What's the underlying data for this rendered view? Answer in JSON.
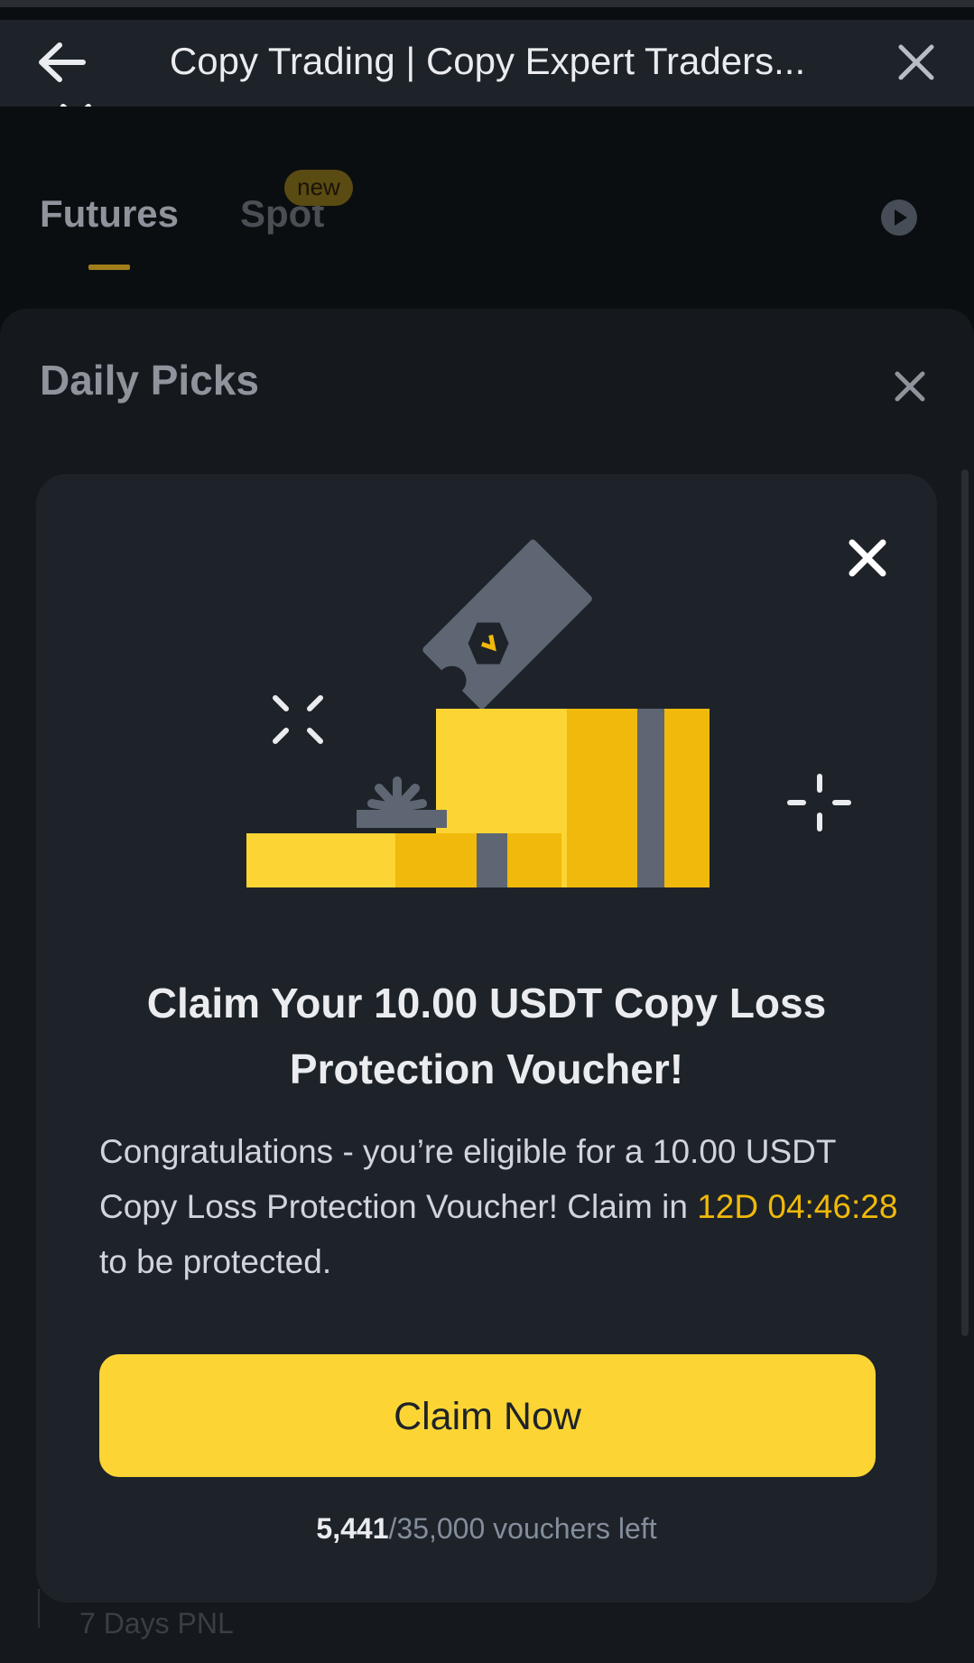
{
  "header": {
    "title": "Copy Trading | Copy Expert Traders..."
  },
  "tabs": [
    {
      "label": "Futures",
      "active": true
    },
    {
      "label": "Spot",
      "badge": "new"
    }
  ],
  "panel": {
    "title": "Daily Picks"
  },
  "modal": {
    "heading_line1": "Claim Your 10.00 USDT Copy Loss",
    "heading_line2": "Protection Voucher!",
    "body_before": "Congratulations - you’re eligible for a 10.00 USDT Copy Loss Protection Voucher! Claim in ",
    "countdown": "12D 04:46:28",
    "body_after": " to be protected.",
    "button_label": "Claim Now",
    "vouchers_left": "5,441",
    "vouchers_total_text": "/35,000 vouchers left"
  },
  "behind": {
    "partial_label": "7 Days PNL"
  },
  "colors": {
    "accent": "#fcd535",
    "highlight": "#f0b90b",
    "background": "#0b0e11",
    "modal_bg": "#1e2329"
  },
  "icons": [
    "back-arrow-icon",
    "close-icon",
    "play-icon",
    "gift-voucher-illustration"
  ]
}
